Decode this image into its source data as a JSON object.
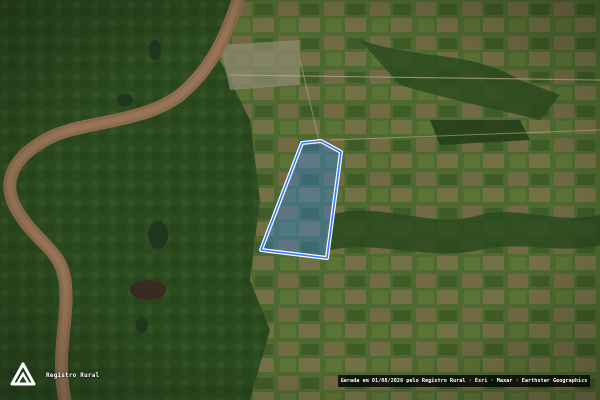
{
  "map": {
    "type": "satellite-imagery",
    "property_boundary": {
      "stroke_color": "#ffffff",
      "inner_color": "#2f7bff",
      "fill_color": "#3a86ff"
    }
  },
  "branding": {
    "logo_icon": "registro-rural-logo-icon",
    "label": "Registro Rural"
  },
  "attribution": {
    "text": "Gerada em 01/08/2026 pelo Registro Rural · Esri · Maxar · Earthstar Geographics"
  }
}
